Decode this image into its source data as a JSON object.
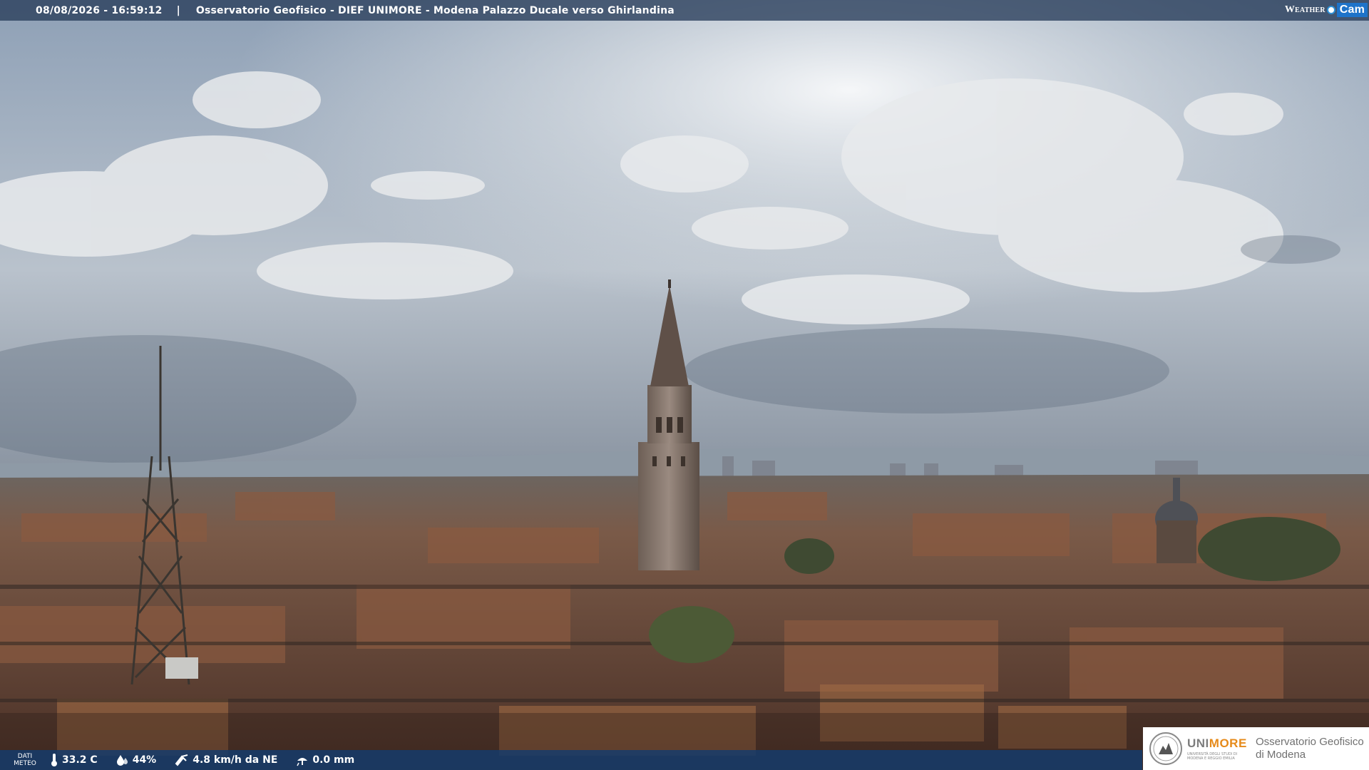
{
  "overlay": {
    "timestamp": "08/08/2026 - 16:59:12",
    "separator": "|",
    "location": "Osservatorio Geofisico - DIEF UNIMORE - Modena Palazzo Ducale verso Ghirlandina",
    "brand_weather": "Weather",
    "brand_cam": "Cam"
  },
  "meteo": {
    "label_line1": "DATI",
    "label_line2": "METEO",
    "temperature": "33.2 C",
    "humidity": "44%",
    "wind": "4.8 km/h da NE",
    "rain": "0.0 mm",
    "icons": [
      "thermometer-icon",
      "humidity-drop-icon",
      "wind-icon",
      "rain-gauge-icon"
    ]
  },
  "institution": {
    "name_main": "UNI",
    "name_accent": "MORE",
    "subtitle_line1": "UNIVERSITÀ DEGLI STUDI DI",
    "subtitle_line2": "MODENA E REGGIO EMILIA",
    "observatory_line1": "Osservatorio Geofisico",
    "observatory_line2": "di Modena",
    "colors": {
      "accent": "#e68a1a",
      "grey": "#7d7d7d"
    }
  },
  "colors": {
    "sky_top": "#8fa2b8",
    "sky_bright": "#f2f2ee",
    "horizon": "#9aa3ad",
    "roofs": "#6b4a3a",
    "topbar": "#283c5a",
    "bottombar": "#143c6e"
  }
}
